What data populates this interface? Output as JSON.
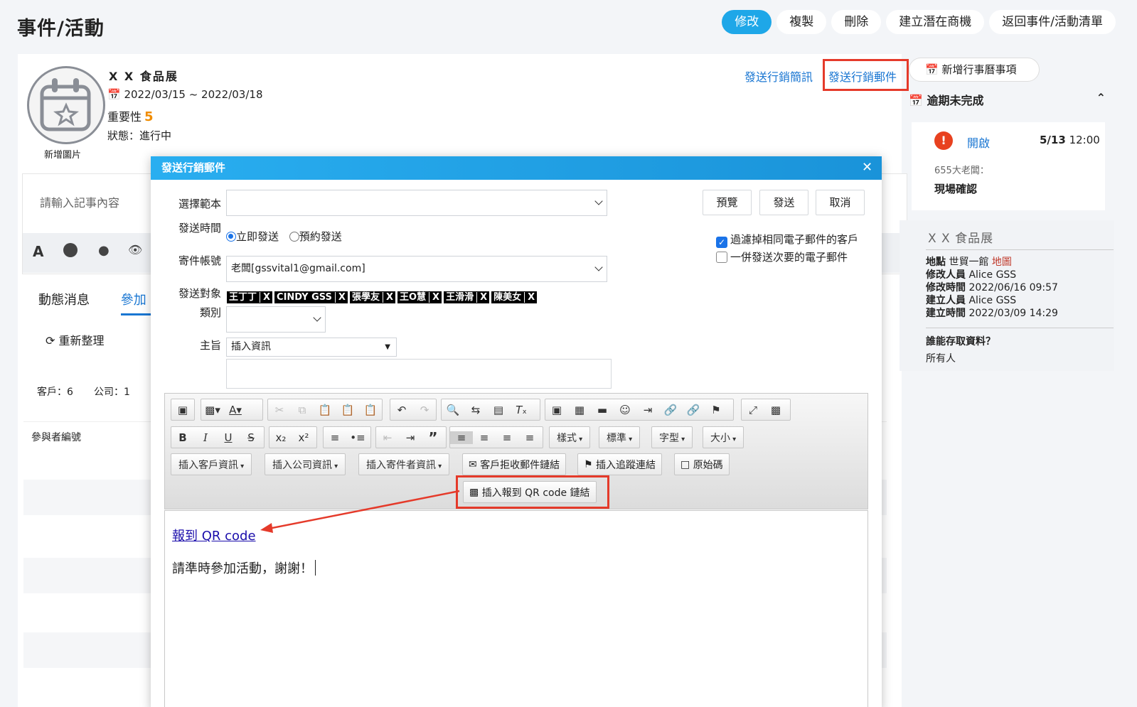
{
  "page": {
    "title": "事件/活動"
  },
  "top_buttons": {
    "edit": "修改",
    "copy": "複製",
    "delete": "刪除",
    "create_opportunity": "建立潛在商機",
    "back_to_list": "返回事件/活動清單"
  },
  "event": {
    "name": "X X 食品展",
    "date_range": "2022/03/15 ~ 2022/03/18",
    "importance_label": "重要性",
    "importance_value": "5",
    "status": "狀態：進行中",
    "add_image": "新增圖片"
  },
  "actions": {
    "send_sms": "發送行銷簡訊",
    "send_email": "發送行銷郵件"
  },
  "notes": {
    "placeholder": "請輸入記事內容"
  },
  "tabs": {
    "news": "動態消息",
    "participants": "參加"
  },
  "list": {
    "refresh": "重新整理",
    "customers": "客戶：6",
    "companies": "公司：1",
    "col_participant_no": "參與者編號"
  },
  "dialog": {
    "title": "發送行銷郵件",
    "labels": {
      "template": "選擇範本",
      "send_time": "發送時間",
      "sender_account": "寄件帳號",
      "recipients": "發送對象",
      "category": "類別",
      "subject": "主旨"
    },
    "template_value": "",
    "send_time_options": [
      "立即發送",
      "預約發送"
    ],
    "sender_value": "老闆[gssvital1@gmail.com]",
    "recipients": [
      "王丁丁",
      "CINDY GSS",
      "張學友",
      "王O慧",
      "王滑滑",
      "陳美女"
    ],
    "tag_remove": "X",
    "insert_info": "插入資訊",
    "buttons": {
      "preview": "預覽",
      "send": "發送",
      "cancel": "取消"
    },
    "checkboxes": {
      "filter_duplicates": "過濾掉相同電子郵件的客戶",
      "send_secondary": "一併發送次要的電子郵件"
    },
    "toolbar": {
      "styles": "樣式",
      "normal": "標準",
      "font": "字型",
      "size": "大小",
      "insert_customer": "插入客戶資訊",
      "insert_company": "插入公司資訊",
      "insert_sender": "插入寄件者資訊",
      "unsubscribe_link": "客戶拒收郵件鏈結",
      "tracking_link": "插入追蹤連結",
      "source": "原始碼",
      "qr_link": "插入報到 QR code 鏈結"
    },
    "editor": {
      "link_text": "報到 QR code",
      "body_text": "請準時參加活動，謝謝！"
    }
  },
  "sidebar": {
    "add_calendar": "新增行事曆事項",
    "overdue_title": "逾期未完成",
    "task": {
      "status": "開啟",
      "date": "5/13",
      "time": "12:00",
      "owner": "655大老闆：",
      "name": "現場確認"
    },
    "info": {
      "title": "X X 食品展",
      "location_label": "地點",
      "location_value": "世貿一館",
      "map_link": "地圖",
      "modified_by_label": "修改人員",
      "modified_by": "Alice GSS",
      "modified_time_label": "修改時間",
      "modified_time": "2022/06/16 09:57",
      "created_by_label": "建立人員",
      "created_by": "Alice GSS",
      "created_time_label": "建立時間",
      "created_time": "2022/03/09 14:29",
      "access_label": "誰能存取資料？",
      "access_value": "所有人"
    }
  },
  "colors": {
    "primary": "#1ea7e8",
    "highlight": "#e53a2a",
    "importance": "#f08c00",
    "link": "#1976d2"
  }
}
